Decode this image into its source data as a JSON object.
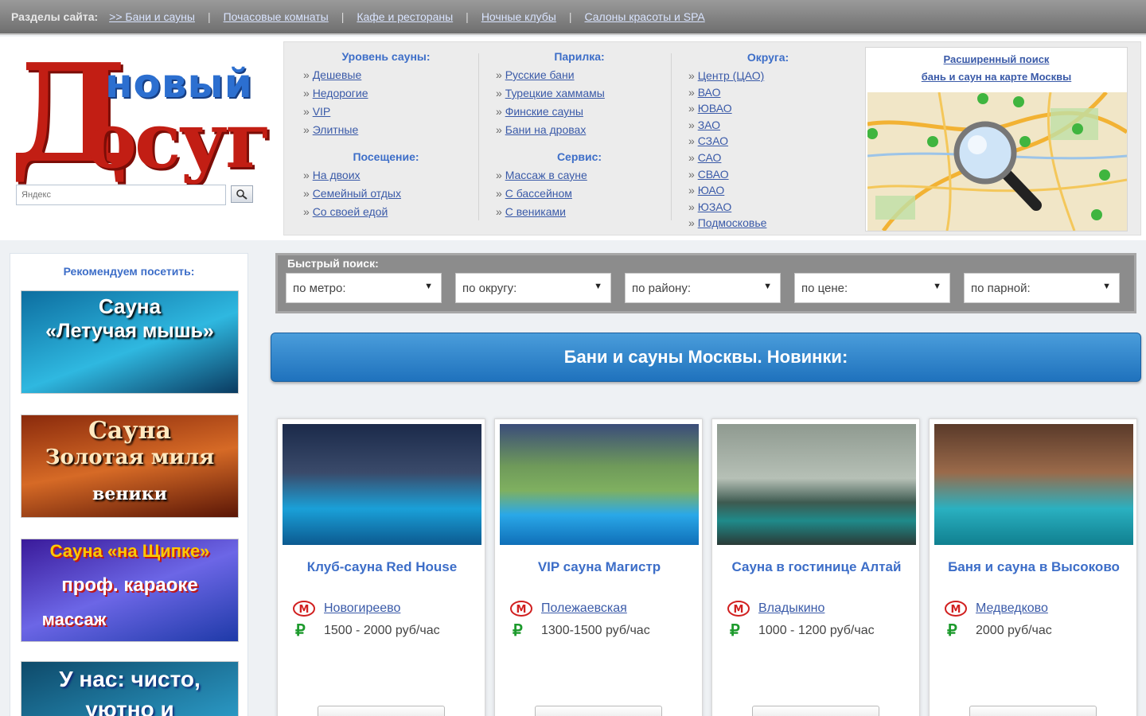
{
  "topnav": {
    "lead": "Разделы сайта:",
    "links": [
      ">> Бани и сауны",
      "Почасовые комнаты",
      "Кафе и рестораны",
      "Ночные клубы",
      "Салоны красоты и SPA"
    ]
  },
  "logo": {
    "top": "новый",
    "big": "Д",
    "rest": "осуг"
  },
  "search": {
    "placeholder": "Яндекс"
  },
  "menu": {
    "col1": {
      "heading": "Уровень сауны:",
      "items": [
        "Дешевые",
        "Недорогие",
        "VIP",
        "Элитные"
      ],
      "heading2": "Посещение:",
      "items2": [
        "На двоих",
        "Семейный отдых",
        "Со своей едой"
      ]
    },
    "col2": {
      "heading": "Парилка:",
      "items": [
        "Русские бани",
        "Турецкие хаммамы",
        "Финские сауны",
        "Бани на дровах"
      ],
      "heading2": "Сервис:",
      "items2": [
        "Массаж в сауне",
        "С бассейном",
        "С вениками"
      ]
    },
    "col3": {
      "heading": "Округа:",
      "items": [
        "Центр (ЦАО)",
        "ВАО",
        "ЮВАО",
        "ЗАО",
        "СЗАО",
        "САО",
        "СВАО",
        "ЮАО",
        "ЮЗАО",
        "Подмосковье"
      ]
    },
    "map": {
      "line1": "Расширенный поиск",
      "line2": "бань и саун на карте Москвы"
    }
  },
  "sidebar": {
    "heading": "Рекомендуем посетить:",
    "banners": [
      {
        "line1": "Сауна",
        "line2": "«Летучая мышь»"
      },
      {
        "line1": "Сауна",
        "line2": "Золотая миля",
        "line3": "веники"
      },
      {
        "line1": "Сауна «на Щипке»",
        "line2": "проф. караоке",
        "line3": "массаж"
      },
      {
        "line1": "У нас: чисто,",
        "line2": "уютно и"
      }
    ]
  },
  "quick": {
    "heading": "Быстрый поиск:",
    "selects": [
      "по метро:",
      "по округу:",
      "по району:",
      "по цене:",
      "по парной:"
    ]
  },
  "section_title": "Бани и сауны Москвы. Новинки:",
  "cards": [
    {
      "title": "Клуб-сауна Red House",
      "metro": "Новогиреево",
      "price": "1500 - 2000 руб/час"
    },
    {
      "title": "VIP сауна Магистр",
      "metro": "Полежаевская",
      "price": "1300-1500 руб/час"
    },
    {
      "title": "Сауна в гостинице Алтай",
      "metro": "Владыкино",
      "price": "1000 - 1200 руб/час"
    },
    {
      "title": "Баня и сауна в Высоково",
      "metro": "Медведково",
      "price": "2000 руб/час"
    }
  ],
  "colors": {
    "accent_blue": "#1f72bd",
    "logo_red": "#c21e14",
    "link": "#3a5aa8",
    "ruble_green": "#1c9a2c"
  }
}
